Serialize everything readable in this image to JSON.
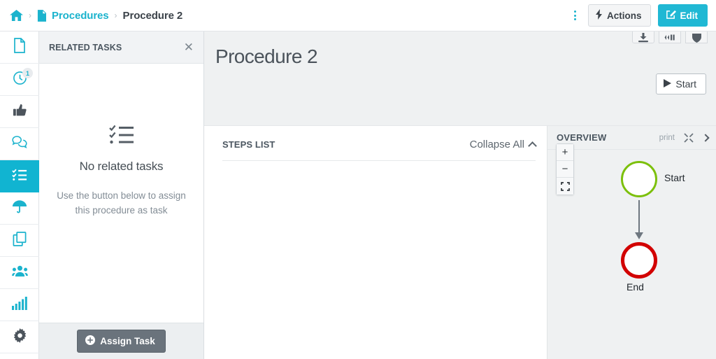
{
  "breadcrumb": {
    "home_icon": "home-icon",
    "doc_icon": "file-icon",
    "separator": "›",
    "parent_label": "Procedures",
    "current_label": "Procedure 2"
  },
  "topbar": {
    "kebab_icon": "more-vertical-icon",
    "actions_label": "Actions",
    "actions_icon": "bolt-icon",
    "edit_label": "Edit",
    "edit_icon": "pencil-square-icon",
    "accent_color": "#20b8d4"
  },
  "sidebar": {
    "items": [
      {
        "name": "documents",
        "icon": "file-icon",
        "badge": null,
        "active": false,
        "style": "teal"
      },
      {
        "name": "history",
        "icon": "clock-icon",
        "badge": "1",
        "active": false,
        "style": "teal"
      },
      {
        "name": "approvals",
        "icon": "thumbs-up-icon",
        "badge": null,
        "active": false,
        "style": "dark"
      },
      {
        "name": "comments",
        "icon": "comments-icon",
        "badge": null,
        "active": false,
        "style": "teal"
      },
      {
        "name": "related-tasks",
        "icon": "checklist-icon",
        "badge": null,
        "active": true,
        "style": "active"
      },
      {
        "name": "publish",
        "icon": "umbrella-icon",
        "badge": null,
        "active": false,
        "style": "teal"
      },
      {
        "name": "copies",
        "icon": "copy-icon",
        "badge": null,
        "active": false,
        "style": "teal"
      },
      {
        "name": "teams",
        "icon": "users-icon",
        "badge": null,
        "active": false,
        "style": "teal"
      },
      {
        "name": "analytics",
        "icon": "bar-chart-icon",
        "badge": null,
        "active": false,
        "style": "teal"
      },
      {
        "name": "settings",
        "icon": "gear-icon",
        "badge": null,
        "active": false,
        "style": "dark"
      }
    ]
  },
  "tasks_panel": {
    "title": "RELATED TASKS",
    "close_icon": "close-icon",
    "empty_icon": "checklist-icon",
    "empty_title": "No related tasks",
    "empty_subtitle": "Use the button below to assign this procedure as task",
    "assign_label": "Assign Task",
    "assign_icon": "plus-circle-icon"
  },
  "hero": {
    "title": "Procedure 2",
    "start_label": "Start",
    "start_icon": "play-icon",
    "tools": [
      {
        "name": "export",
        "icon": "download-icon"
      },
      {
        "name": "reorder",
        "icon": "arrows-icon"
      },
      {
        "name": "info",
        "icon": "shield-icon"
      }
    ]
  },
  "steps": {
    "title": "STEPS LIST",
    "collapse_label": "Collapse All",
    "collapse_icon": "chevron-up-icon",
    "rows": []
  },
  "overview": {
    "title": "OVERVIEW",
    "print_label": "print",
    "expand_icon": "expand-arrows-icon",
    "collapse_icon": "chevron-right-icon",
    "zoom_in": "+",
    "zoom_out": "−",
    "zoom_fit_icon": "fit-screen-icon",
    "diagram": {
      "start_label": "Start",
      "end_label": "End",
      "start_color": "#7cc00c",
      "end_color": "#d20000",
      "arrow_color": "#6e7780"
    }
  }
}
